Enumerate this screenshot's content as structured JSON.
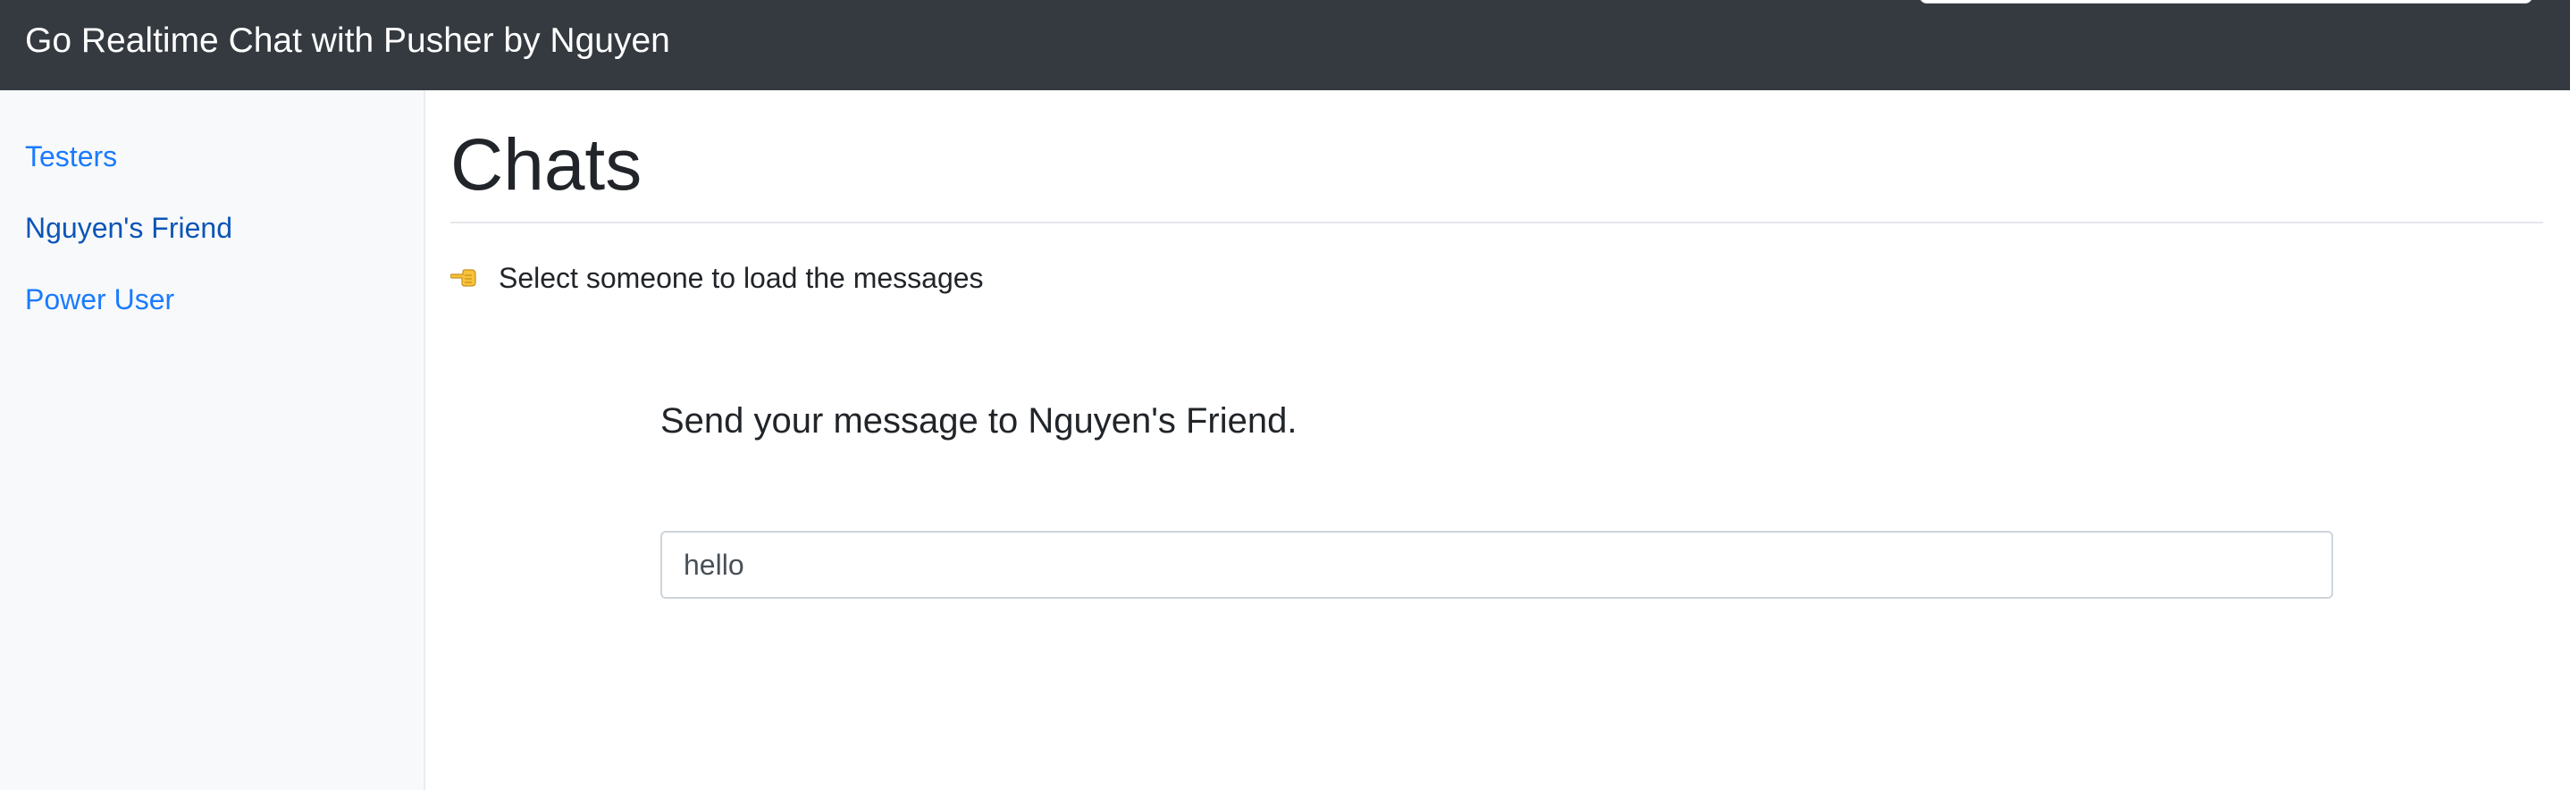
{
  "navbar": {
    "brand": "Go Realtime Chat with Pusher by Nguyen",
    "background_color": "#343a40"
  },
  "sidebar": {
    "items": [
      {
        "label": "Testers",
        "active": false
      },
      {
        "label": "Nguyen's Friend",
        "active": true
      },
      {
        "label": "Power User",
        "active": false
      }
    ],
    "link_color": "#1a7bff",
    "active_link_color": "#0b55b7"
  },
  "main": {
    "title": "Chats",
    "hint": {
      "icon": "pointing-left-hand-icon",
      "text": "Select someone to load the messages"
    },
    "send_heading": "Send your message to Nguyen's Friend.",
    "message_input": {
      "value": "hello",
      "placeholder": ""
    }
  }
}
